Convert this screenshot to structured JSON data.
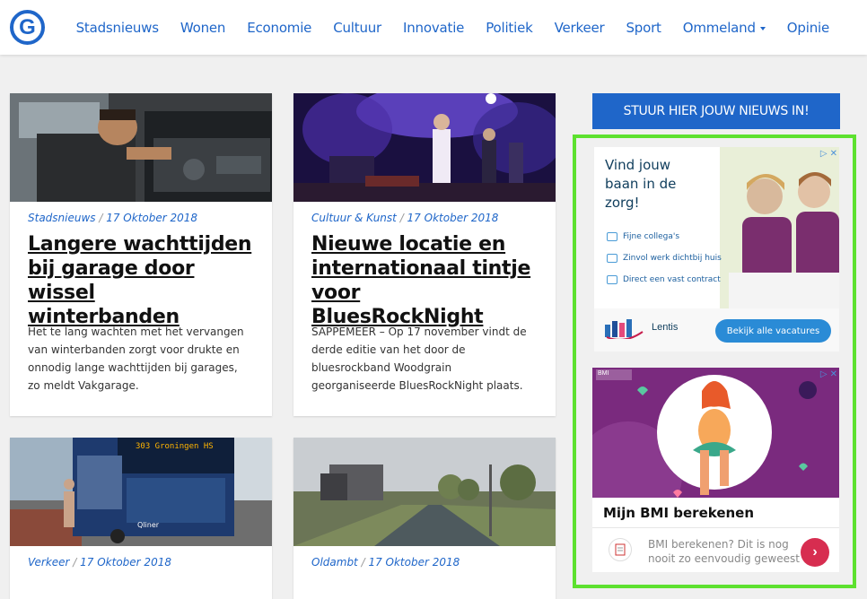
{
  "header": {
    "logo_letter": "G",
    "nav": [
      "Stadsnieuws",
      "Wonen",
      "Economie",
      "Cultuur",
      "Innovatie",
      "Politiek",
      "Verkeer",
      "Sport",
      "Ommeland",
      "Opinie"
    ]
  },
  "sidebar": {
    "submit_button": "STUUR HIER JOUW NIEUWS IN!",
    "ad1": {
      "headline": "Vind jouw baan in de zorg!",
      "items": [
        "Fijne collega's",
        "Zinvol werk dichtbij huis",
        "Direct een vast contract"
      ],
      "brand": "Lentis",
      "cta": "Bekijk alle vacatures"
    },
    "ad2": {
      "badge": "BMI",
      "title": "Mijn BMI berekenen",
      "text": "BMI berekenen? Dit is nog nooit zo eenvoudig geweest",
      "arrow": "›"
    }
  },
  "articles": [
    {
      "category": "Stadsnieuws",
      "date": "17 Oktober 2018",
      "title": "Langere wachttijden bij garage door wissel winterbanden",
      "excerpt": "Het te lang wachten met het vervangen van winterbanden zorgt voor drukte en onnodig lange wachttijden bij garages, zo meldt Vakgarage."
    },
    {
      "category": "Cultuur & Kunst",
      "date": "17 Oktober 2018",
      "title": "Nieuwe locatie en internationaal tintje voor BluesRockNight",
      "excerpt": "SAPPEMEER – Op 17 november vindt de derde editie van het door de bluesrockband Woodgrain georganiseerde BluesRockNight plaats."
    },
    {
      "category": "Verkeer",
      "date": "17 Oktober 2018",
      "bus_sign": "303 Groningen HS",
      "bus_brand": "Qliner"
    },
    {
      "category": "Oldambt",
      "date": "17 Oktober 2018"
    }
  ]
}
